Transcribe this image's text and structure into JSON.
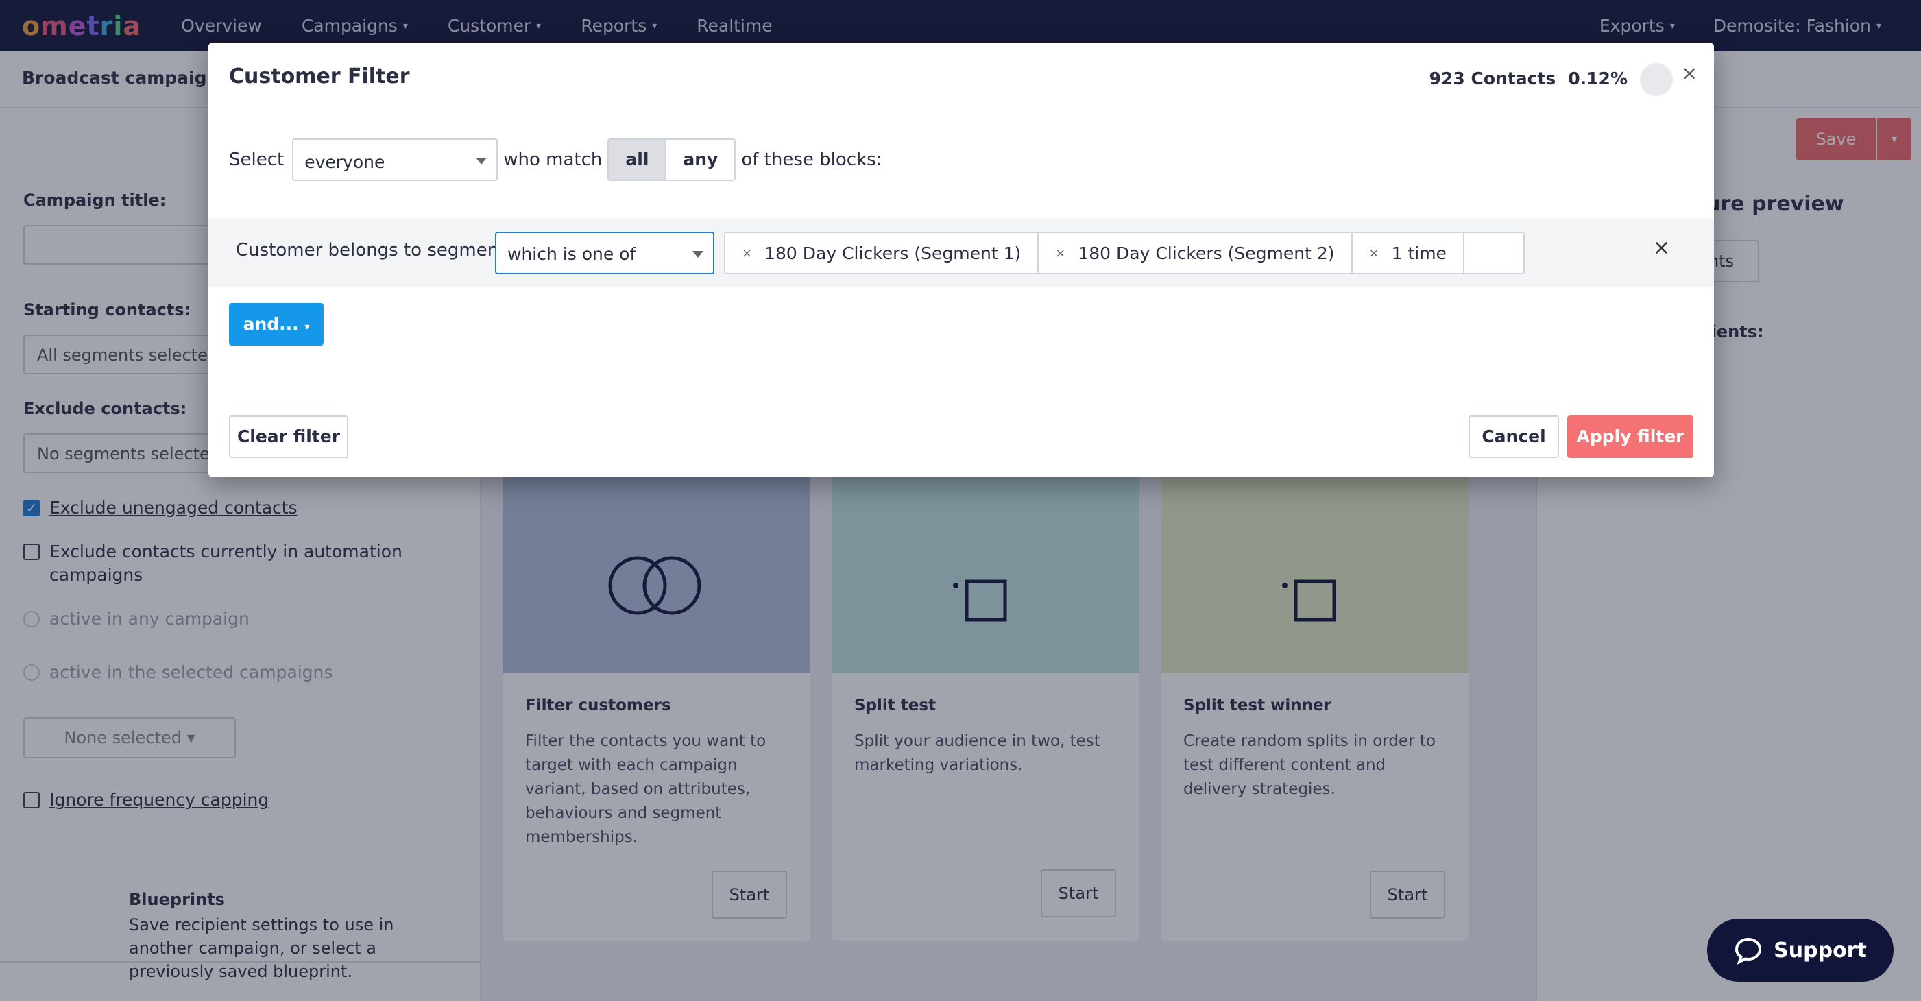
{
  "nav": {
    "logo": "ometria",
    "items": [
      "Overview",
      "Campaigns",
      "Customer",
      "Reports",
      "Realtime"
    ],
    "right_items": [
      "Exports",
      "Demosite: Fashion"
    ]
  },
  "page": {
    "breadcrumb": "Broadcast campaigns",
    "save_label": "Save",
    "campaign_title_label": "Campaign title:",
    "starting_contacts_label": "Starting contacts:",
    "starting_contacts_value": "All segments selecte",
    "exclude_contacts_label": "Exclude contacts:",
    "exclude_contacts_value": "No segments selecte",
    "exclude_unengaged": "Exclude unengaged contacts",
    "exclude_automation": "Exclude contacts currently in automation campaigns",
    "radio_any": "active in any campaign",
    "radio_selected": "active in the selected campaigns",
    "none_selected": "None selected",
    "ignore_capping": "Ignore frequency capping",
    "blueprints_title": "Blueprints",
    "blueprints_text": "Save recipient settings to use in another campaign, or select a previously saved blueprint.",
    "right_heading": "cture preview",
    "right_button": "nts",
    "right_label": "cipients:"
  },
  "cards": [
    {
      "title": "Filter customers",
      "desc": "Filter the contacts you want to target with each campaign variant, based on attributes, behaviours and segment memberships.",
      "start": "Start",
      "color": "#b3bfdc"
    },
    {
      "title": "Split test",
      "desc": "Split your audience in two, test marketing variations.",
      "start": "Start",
      "color": "#bfe4e0"
    },
    {
      "title": "Split test winner",
      "desc": "Create random splits in order to test different content and delivery strategies.",
      "start": "Start",
      "color": "#e4ecc4"
    }
  ],
  "modal": {
    "title": "Customer Filter",
    "contacts": "923 Contacts",
    "percent": "0.12%",
    "close_glyph": "×",
    "select_label": "Select",
    "select_value": "everyone",
    "who_match": "who match",
    "match_all": "all",
    "match_any": "any",
    "of_blocks": "of these blocks:",
    "block": {
      "label": "Customer belongs to segment",
      "operator": "which is one of",
      "tags": [
        "180 Day Clickers (Segment 1)",
        "180 Day Clickers (Segment 2)",
        "1 time"
      ],
      "tag_remove_glyph": "×"
    },
    "and_button": "and...",
    "clear_button": "Clear filter",
    "cancel_button": "Cancel",
    "apply_button": "Apply filter"
  },
  "support": {
    "label": "Support"
  }
}
